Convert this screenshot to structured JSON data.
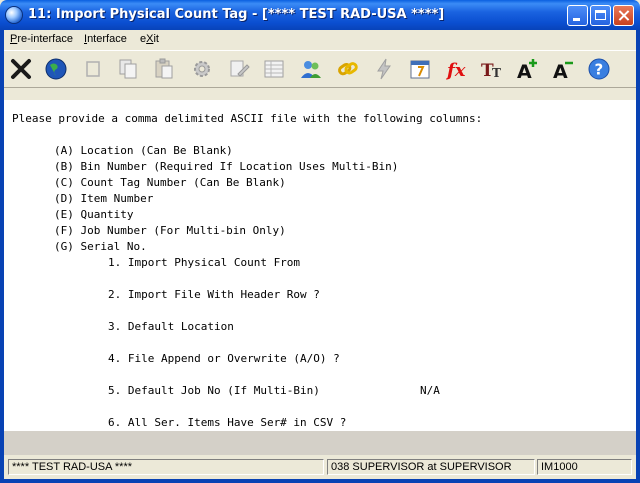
{
  "window": {
    "title": "11: Import Physical Count Tag - [**** TEST RAD-USA ****]"
  },
  "menu": [
    {
      "pre": "",
      "ul": "P",
      "post": "re-interface"
    },
    {
      "pre": "",
      "ul": "I",
      "post": "nterface"
    },
    {
      "pre": "e",
      "ul": "X",
      "post": "it"
    }
  ],
  "toolbar": [
    {
      "name": "close-tool-icon"
    },
    {
      "name": "globe-icon"
    },
    {
      "name": "blank-page-icon"
    },
    {
      "name": "copy-icon"
    },
    {
      "name": "paste-icon"
    },
    {
      "name": "settings-gear-icon"
    },
    {
      "name": "edit-document-icon"
    },
    {
      "name": "spreadsheet-icon"
    },
    {
      "name": "users-icon"
    },
    {
      "name": "chain-link-icon"
    },
    {
      "name": "lightning-icon"
    },
    {
      "name": "calendar-icon"
    },
    {
      "name": "function-fx-icon"
    },
    {
      "name": "font-size-icon"
    },
    {
      "name": "increase-font-icon"
    },
    {
      "name": "decrease-font-icon"
    },
    {
      "name": "help-icon"
    }
  ],
  "content": {
    "intro": "Please provide a comma delimited ASCII file with the following columns:",
    "columns": [
      "(A) Location (Can Be Blank)",
      "(B) Bin Number (Required If Location Uses Multi-Bin)",
      "(C) Count Tag Number (Can Be Blank)",
      "(D) Item Number",
      "(E) Quantity",
      "(F) Job Number (For Multi-bin Only)",
      "(G) Serial No."
    ],
    "options": [
      "1. Import Physical Count From",
      "2. Import File With Header Row ?",
      "3. Default Location",
      "4. File Append or Overwrite (A/O) ?",
      "5. Default Job No (If Multi-Bin)",
      "6. All Ser. Items Have Ser# in CSV ?"
    ],
    "option5_value": "N/A"
  },
  "status": {
    "company": "**** TEST RAD-USA ****",
    "user": "038 SUPERVISOR at SUPERVISOR",
    "program": "IM1000"
  }
}
